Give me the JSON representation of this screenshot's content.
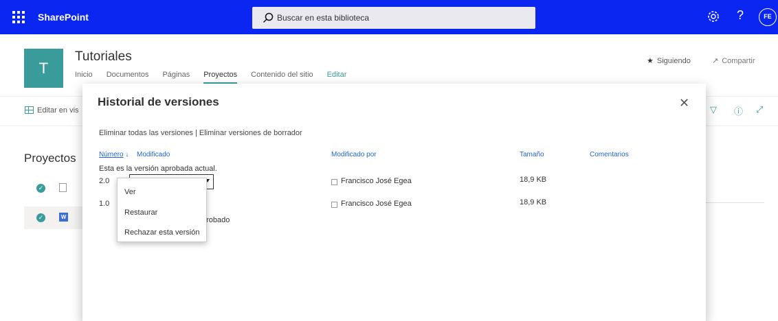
{
  "suite": {
    "app_name": "SharePoint",
    "search_placeholder": "Buscar en esta biblioteca",
    "help_label": "?",
    "user_initials": "FE",
    "icons": [
      "waffle-icon",
      "search-icon",
      "gear-icon",
      "help-icon"
    ]
  },
  "site": {
    "logo_letter": "T",
    "title": "Tutoriales",
    "nav": [
      "Inicio",
      "Documentos",
      "Páginas",
      "Proyectos",
      "Contenido del sitio",
      "Editar"
    ],
    "active_nav": "Proyectos",
    "follow_label": "Siguiendo",
    "share_label": "Compartir",
    "accent_color": "#3a9b9b",
    "suitebar_color": "#0b26f0"
  },
  "page": {
    "edit_grid_label": "Editar en vis",
    "library_title": "Proyectos"
  },
  "dialog": {
    "title": "Historial de versiones",
    "actions_text": "Eliminar todas las versiones | Eliminar versiones de borrador",
    "columns": {
      "number": "Número",
      "modified": "Modificado",
      "modified_by": "Modificado por",
      "size": "Tamaño",
      "comments": "Comentarios"
    },
    "current_note": "Esta es la versión aprobada actual.",
    "versions": [
      {
        "number": "2.0",
        "modified_by": "Francisco José Egea",
        "size": "18,9 KB"
      },
      {
        "number": "1.0",
        "modified_by": "Francisco José Egea",
        "size": "18,9 KB"
      }
    ],
    "approved_tail": "probado"
  },
  "context_menu": {
    "items": [
      "Ver",
      "Restaurar",
      "Rechazar esta versión"
    ]
  }
}
